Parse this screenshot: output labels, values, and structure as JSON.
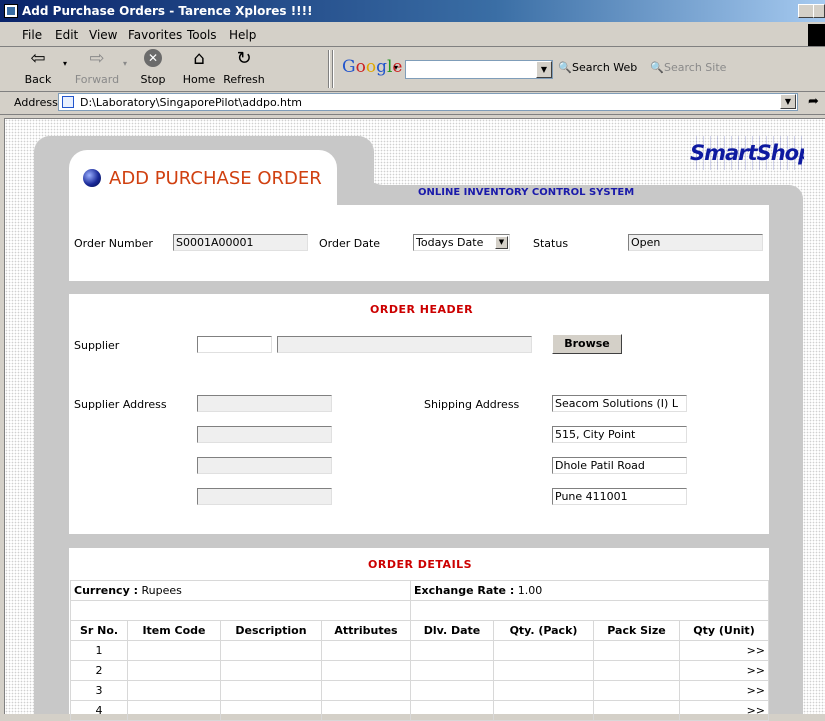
{
  "window": {
    "title": "Add Purchase Orders - Tarence Xplores !!!!"
  },
  "menu": [
    "File",
    "Edit",
    "View",
    "Favorites",
    "Tools",
    "Help"
  ],
  "toolbar": {
    "back": "Back",
    "forward": "Forward",
    "stop": "Stop",
    "home": "Home",
    "refresh": "Refresh",
    "google_search_web": "Search Web",
    "google_search_site": "Search Site"
  },
  "google_logo": [
    "G",
    "o",
    "o",
    "g",
    "l",
    "e"
  ],
  "address": {
    "label": "Address",
    "url": "D:\\Laboratory\\SingaporePilot\\addpo.htm"
  },
  "brand": {
    "logo_text": "SmartShop",
    "tagline": "ONLINE INVENTORY CONTROL SYSTEM"
  },
  "page": {
    "title": "ADD PURCHASE ORDER"
  },
  "order": {
    "number_label": "Order Number",
    "number_value": "S0001A00001",
    "date_label": "Order Date",
    "date_value": "Todays Date",
    "status_label": "Status",
    "status_value": "Open"
  },
  "header": {
    "title": "ORDER HEADER",
    "supplier_label": "Supplier",
    "browse_label": "Browse",
    "supplier_address_label": "Supplier Address",
    "shipping_address_label": "Shipping Address",
    "shipping_lines": [
      "Seacom Solutions (I) L",
      "515, City Point",
      "Dhole Patil Road",
      "Pune 411001"
    ]
  },
  "details": {
    "title": "ORDER DETAILS",
    "currency_label": "Currency :",
    "currency_value": "Rupees",
    "exchange_label": "Exchange Rate :",
    "exchange_value": "1.00",
    "columns": [
      "Sr No.",
      "Item Code",
      "Description",
      "Attributes",
      "Dlv. Date",
      "Qty. (Pack)",
      "Pack Size",
      "Qty (Unit)"
    ],
    "rows": [
      "1",
      "2",
      "3",
      "4"
    ],
    "row_action": ">>"
  }
}
